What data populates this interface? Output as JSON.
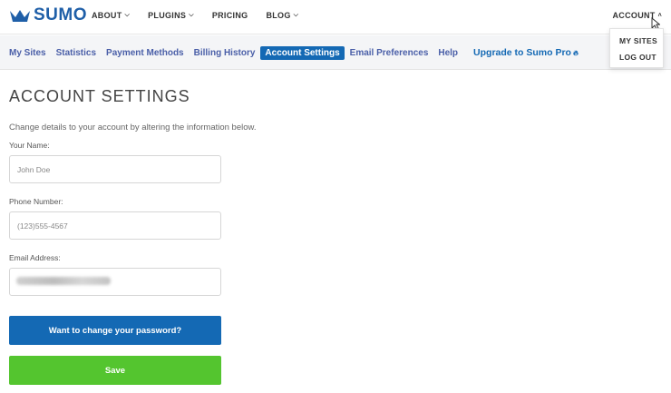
{
  "brand": {
    "name": "SUMO",
    "color": "#1f5fa8"
  },
  "topnav": {
    "items": [
      {
        "label": "ABOUT",
        "has_dropdown": true
      },
      {
        "label": "PLUGINS",
        "has_dropdown": true
      },
      {
        "label": "PRICING",
        "has_dropdown": false
      },
      {
        "label": "BLOG",
        "has_dropdown": true
      }
    ],
    "account_label": "ACCOUNT",
    "dropdown_items": [
      "MY SITES",
      "LOG OUT"
    ]
  },
  "subnav": {
    "items": [
      {
        "label": "My Sites",
        "active": false
      },
      {
        "label": "Statistics",
        "active": false
      },
      {
        "label": "Payment Methods",
        "active": false
      },
      {
        "label": "Billing History",
        "active": false
      },
      {
        "label": "Account Settings",
        "active": true
      },
      {
        "label": "Email Preferences",
        "active": false
      },
      {
        "label": "Help",
        "active": false
      }
    ],
    "upgrade_label": "Upgrade to Sumo Pro",
    "active_color": "#1469b4"
  },
  "page": {
    "title": "ACCOUNT SETTINGS",
    "intro": "Change details to your account by altering the information below."
  },
  "form": {
    "name_label": "Your Name:",
    "name_placeholder": "John Doe",
    "phone_label": "Phone Number:",
    "phone_placeholder": "(123)555-4567",
    "email_label": "Email Address:",
    "password_button": "Want to change your password?",
    "save_button": "Save",
    "save_color": "#54c52f"
  }
}
